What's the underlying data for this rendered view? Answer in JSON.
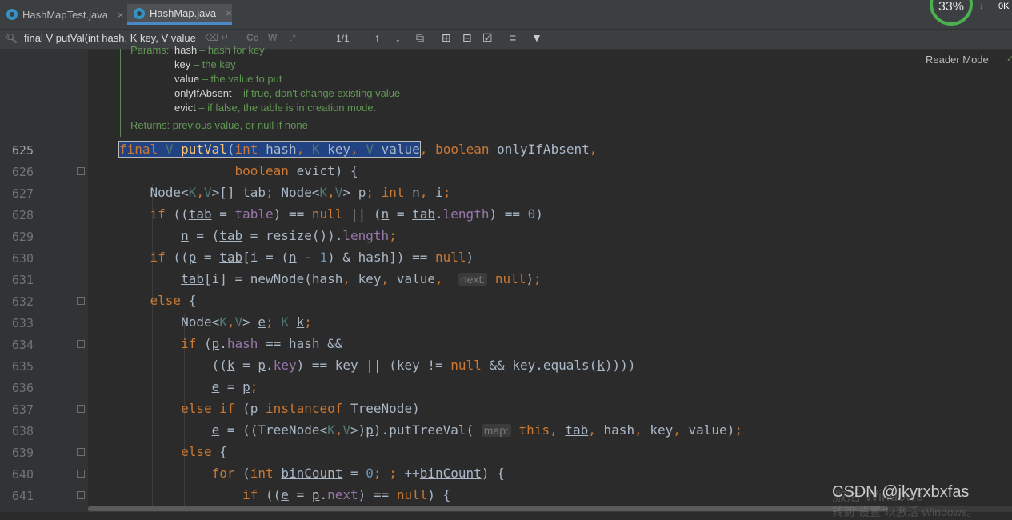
{
  "tabs": [
    {
      "label": "HashMapTest.java",
      "close": "×"
    },
    {
      "label": "HashMap.java",
      "close": "×"
    }
  ],
  "status": {
    "gauge": "33%",
    "net_arrow": "↓",
    "net_value": "0K"
  },
  "search": {
    "query": "final V putVal(int hash, K key, V value",
    "match_count": "1/1",
    "case_label": "Cc",
    "word_label": "W",
    "regex_label": ".*"
  },
  "doc": {
    "params_label": "Params:",
    "params": [
      {
        "name": "hash",
        "desc": " – hash for key"
      },
      {
        "name": "key",
        "desc": " – the key"
      },
      {
        "name": "value",
        "desc": " – the value to put"
      },
      {
        "name": "onlyIfAbsent",
        "desc": " – if true, don't change existing value"
      },
      {
        "name": "evict",
        "desc": " – if false, the table is in creation mode."
      }
    ],
    "returns": "Returns: previous value, or null if none",
    "reader_mode": "Reader Mode"
  },
  "line_numbers": [
    "625",
    "626",
    "627",
    "628",
    "629",
    "630",
    "631",
    "632",
    "633",
    "634",
    "635",
    "636",
    "637",
    "638",
    "639",
    "640",
    "641"
  ],
  "hints": {
    "next": "next:",
    "map": "map:"
  },
  "watermark": "CSDN @jkyrxbxfas",
  "windows_activate": "激活 Windows",
  "windows_activate_sub": "转到\"设置\"以激活 Windows。",
  "colors": {
    "keyword": "#cc7832",
    "number": "#6897bb",
    "method": "#ffc66d",
    "field": "#9876aa",
    "doc": "#629755",
    "selection": "#214283"
  }
}
